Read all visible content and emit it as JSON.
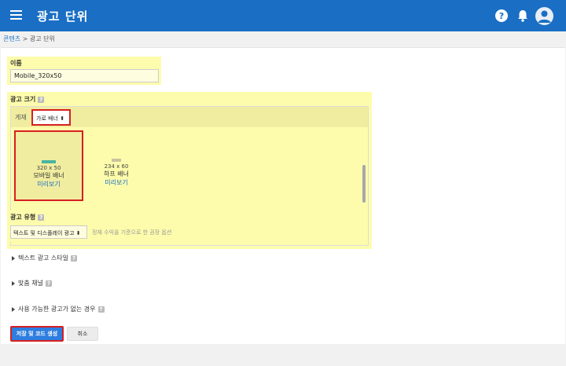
{
  "header": {
    "title": "광고 단위",
    "background": "#1a6fc4"
  },
  "breadcrumb": {
    "parent": "콘텐츠",
    "separator": ">",
    "current": "광고 단위"
  },
  "name_field": {
    "label": "이름",
    "value": "Mobile_320x50"
  },
  "ad_size": {
    "label": "광고 크기",
    "placement_label": "게재",
    "placement_value": "가로 배너 ⬍",
    "options": [
      {
        "dimensions": "320 x 50",
        "name": "모바일 배너",
        "preview": "미리보기",
        "selected": true,
        "swatch_color": "#4cb3a0"
      },
      {
        "dimensions": "234 x 60",
        "name": "하프 배너",
        "preview": "미리보기",
        "selected": false,
        "swatch_color": "#c9c3a0"
      }
    ]
  },
  "ad_type": {
    "label": "광고 유형",
    "value": "텍스트 및 디스플레이 광고 ⬍",
    "hint": "정재 수익을 기준으로 한 권장 옵션"
  },
  "sections": [
    {
      "label": "텍스트 광고 스타일"
    },
    {
      "label": "맞춤 채널"
    },
    {
      "label": "사용 가능한 광고가 없는 경우"
    }
  ],
  "buttons": {
    "save": "저장 및 코드 생성",
    "cancel": "취소"
  },
  "colors": {
    "highlight": "#fdfcac",
    "accent": "#1a6fc4",
    "emphasis_border": "#d62020"
  }
}
